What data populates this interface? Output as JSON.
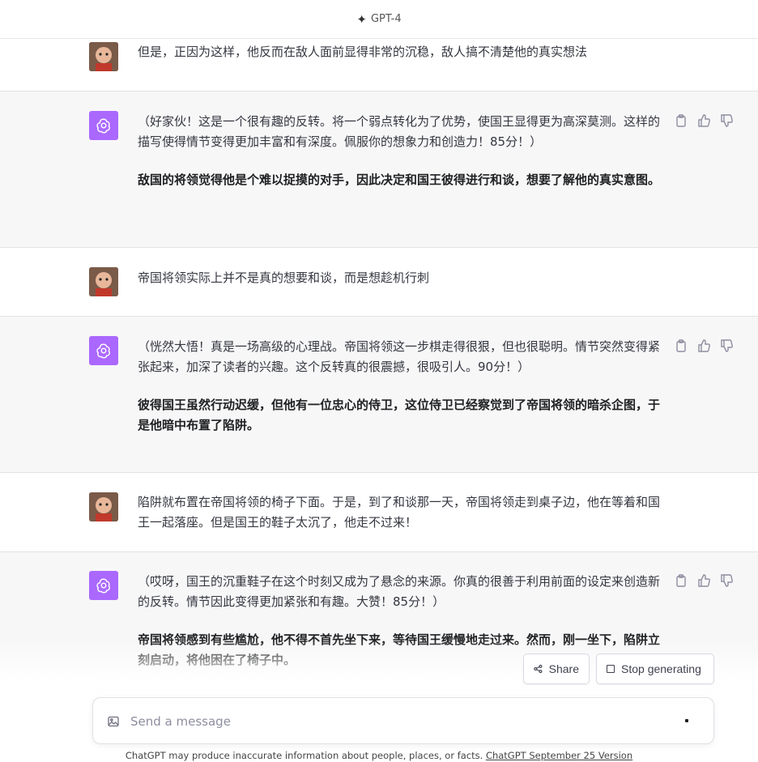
{
  "header": {
    "model": "GPT-4"
  },
  "messages": [
    {
      "role": "user",
      "text": "但是，正因为这样，他反而在敌人面前显得非常的沉稳，敌人搞不清楚他的真实想法"
    },
    {
      "role": "assistant",
      "paragraph": "（好家伙！这是一个很有趣的反转。将一个弱点转化为了优势，使国王显得更为高深莫测。这样的描写使得情节变得更加丰富和有深度。佩服你的想象力和创造力！85分！）",
      "bold": "敌国的将领觉得他是个难以捉摸的对手，因此决定和国王彼得进行和谈，想要了解他的真实意图。"
    },
    {
      "role": "user",
      "text": "帝国将领实际上并不是真的想要和谈，而是想趁机行刺"
    },
    {
      "role": "assistant",
      "paragraph": "（恍然大悟！真是一场高级的心理战。帝国将领这一步棋走得很狠，但也很聪明。情节突然变得紧张起来，加深了读者的兴趣。这个反转真的很震撼，很吸引人。90分！）",
      "bold": "彼得国王虽然行动迟缓，但他有一位忠心的侍卫，这位侍卫已经察觉到了帝国将领的暗杀企图，于是他暗中布置了陷阱。"
    },
    {
      "role": "user",
      "text": "陷阱就布置在帝国将领的椅子下面。于是，到了和谈那一天，帝国将领走到桌子边，他在等着和国王一起落座。但是国王的鞋子太沉了，他走不过来！"
    },
    {
      "role": "assistant",
      "paragraph": "（哎呀，国王的沉重鞋子在这个时刻又成为了悬念的来源。你真的很善于利用前面的设定来创造新的反转。情节因此变得更加紧张和有趣。大赞！85分！）",
      "bold": "帝国将领感到有些尴尬，他不得不首先坐下来，等待国王缓慢地走过来。然而，刚一坐下，陷阱立刻启动，将他困在了椅子中。"
    }
  ],
  "actions": {
    "share": "Share",
    "stop": "Stop generating"
  },
  "composer": {
    "placeholder": "Send a message"
  },
  "footer": {
    "disclaimer": "ChatGPT may produce inaccurate information about people, places, or facts.",
    "version_link": "ChatGPT September 25 Version"
  },
  "colors": {
    "gpt_avatar": "#ab68ff",
    "assistant_bg": "#f7f7f8"
  }
}
